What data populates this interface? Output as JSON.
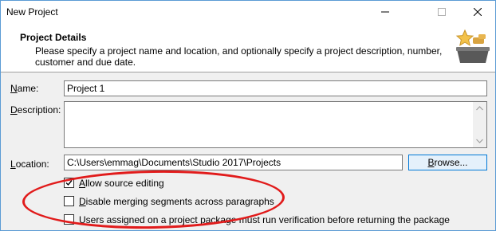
{
  "window": {
    "title": "New Project",
    "controls": {
      "minimize": "minimize-icon",
      "maximize": "maximize-icon",
      "close": "close-icon"
    }
  },
  "header": {
    "title": "Project Details",
    "description": "Please specify a project name and location, and optionally specify a project description, number, customer and due date.",
    "icon": "project-star-icon"
  },
  "form": {
    "name": {
      "label_prefix": "N",
      "label_rest": "ame:",
      "value": "Project 1"
    },
    "description": {
      "label_prefix": "D",
      "label_rest": "escription:",
      "value": ""
    },
    "location": {
      "label_prefix": "L",
      "label_rest": "ocation:",
      "value": "C:\\Users\\emmag\\Documents\\Studio 2017\\Projects",
      "browse_prefix": "B",
      "browse_rest": "rowse..."
    }
  },
  "options": [
    {
      "label_prefix": "A",
      "label_rest": "llow source editing",
      "checked": true
    },
    {
      "label_prefix": "D",
      "label_rest": "isable merging segments across paragraphs",
      "checked": false
    },
    {
      "label": "Users assigned on a project package must run verification before returning the package",
      "checked": false
    }
  ],
  "colors": {
    "window_border": "#5b9bd5",
    "annotation": "#e11b1b",
    "button_border": "#0078d7",
    "button_fill": "#e5f1fb"
  }
}
